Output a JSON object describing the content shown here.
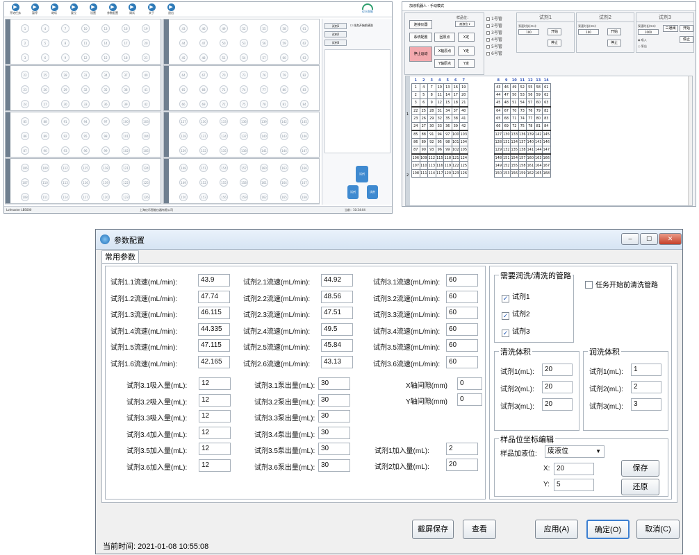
{
  "screen1": {
    "toolbar": [
      {
        "label": "开始任务",
        "icon": "play-icon"
      },
      {
        "label": "暂停",
        "icon": "pause-icon"
      },
      {
        "label": "继续",
        "icon": "resume-icon"
      },
      {
        "label": "复位",
        "icon": "reset-icon"
      },
      {
        "label": "设置",
        "icon": "gear-icon"
      },
      {
        "label": "参数配置",
        "icon": "settings-icon"
      },
      {
        "label": "调试",
        "icon": "debug-icon"
      },
      {
        "label": "关于",
        "icon": "info-icon"
      },
      {
        "label": "退出",
        "icon": "exit-icon"
      }
    ],
    "rows": [
      [
        1,
        4,
        7,
        10,
        13,
        16,
        19
      ],
      [
        2,
        5,
        8,
        11,
        14,
        17,
        20
      ],
      [
        3,
        6,
        9,
        12,
        15,
        18,
        21
      ],
      [
        22,
        25,
        28,
        31,
        34,
        37,
        40
      ],
      [
        23,
        26,
        29,
        32,
        35,
        38,
        41
      ],
      [
        24,
        27,
        30,
        33,
        36,
        39,
        42
      ],
      [
        85,
        88,
        91,
        94,
        97,
        100,
        103
      ],
      [
        86,
        89,
        92,
        95,
        98,
        101,
        104
      ],
      [
        87,
        90,
        93,
        96,
        99,
        102,
        105
      ],
      [
        106,
        109,
        112,
        115,
        118,
        121,
        124
      ],
      [
        107,
        110,
        113,
        116,
        119,
        122,
        125
      ],
      [
        108,
        111,
        114,
        117,
        120,
        123,
        126
      ]
    ],
    "rows_right": [
      [
        43,
        46,
        49,
        52,
        55,
        58,
        61
      ],
      [
        44,
        47,
        50,
        53,
        56,
        59,
        62
      ],
      [
        45,
        48,
        51,
        54,
        57,
        60,
        63
      ],
      [
        64,
        67,
        70,
        73,
        76,
        79,
        82
      ],
      [
        65,
        68,
        71,
        74,
        77,
        80,
        83
      ],
      [
        66,
        69,
        72,
        75,
        78,
        81,
        84
      ],
      [
        127,
        130,
        133,
        136,
        139,
        142,
        145
      ],
      [
        128,
        131,
        134,
        137,
        140,
        143,
        146
      ],
      [
        129,
        132,
        135,
        138,
        141,
        144,
        147
      ],
      [
        148,
        151,
        154,
        157,
        160,
        163,
        166
      ],
      [
        149,
        152,
        155,
        158,
        161,
        164,
        167
      ],
      [
        150,
        153,
        156,
        159,
        162,
        165,
        168
      ]
    ],
    "side_buttons": [
      "试剂1",
      "试剂2",
      "试剂3"
    ],
    "side_check": "任务开始前清洗",
    "logo": "仪乐智能",
    "bottle_label": "试剂",
    "status_left": "Lofmaster  LBS000",
    "status_mid": "上海仪乐智能仪器有限公司",
    "status_right": "当前：10:34:04"
  },
  "screen2": {
    "title": "加液机器人 - 手动模式",
    "buttons": [
      "连接仪器",
      "系统配置",
      "回原点",
      "停止运动",
      "X轴原点",
      "Y轴原点",
      "X定",
      "Y走",
      "Y定"
    ],
    "sample_label": "样品位：",
    "sample_value": "废液位",
    "tubes": [
      "1号管",
      "2号管",
      "3号管",
      "4号管",
      "5号管",
      "6号管"
    ],
    "panels": [
      {
        "title": "试剂1",
        "pump_label": "泵速时长(ms):",
        "pump_value": "100",
        "start": "开始",
        "stop": "停止"
      },
      {
        "title": "试剂2",
        "pump_label": "泵速时长(ms):",
        "pump_value": "100",
        "start": "开始",
        "stop": "停止"
      },
      {
        "title": "试剂3",
        "pump_label": "泵速时长(ms):",
        "pump_value": "1000",
        "start": "开始",
        "stop": "停止",
        "channel": "三通阀",
        "opt1": "吸入",
        "opt2": "泵出"
      }
    ],
    "col_headers_left": [
      "1",
      "2",
      "3",
      "4",
      "5",
      "6",
      "7"
    ],
    "col_headers_right": [
      "8",
      "9",
      "10",
      "11",
      "12",
      "13",
      "14"
    ],
    "side_nums": [
      "1",
      "2"
    ]
  },
  "screen3": {
    "title": "参数配置",
    "tab": "常用参数",
    "rates": {
      "r1": [
        {
          "label": "试剂1.1流速(mL/min):",
          "value": "43.9"
        },
        {
          "label": "试剂1.2流速(mL/min):",
          "value": "47.74"
        },
        {
          "label": "试剂1.3流速(mL/min):",
          "value": "46.115"
        },
        {
          "label": "试剂1.4流速(mL/min):",
          "value": "44.335"
        },
        {
          "label": "试剂1.5流速(mL/min):",
          "value": "47.115"
        },
        {
          "label": "试剂1.6流速(mL/min):",
          "value": "42.165"
        }
      ],
      "r2": [
        {
          "label": "试剂2.1流速(mL/min):",
          "value": "44.92"
        },
        {
          "label": "试剂2.2流速(mL/min):",
          "value": "48.56"
        },
        {
          "label": "试剂2.3流速(mL/min):",
          "value": "47.51"
        },
        {
          "label": "试剂2.4流速(mL/min):",
          "value": "49.5"
        },
        {
          "label": "试剂2.5流速(mL/min):",
          "value": "45.84"
        },
        {
          "label": "试剂2.6流速(mL/min):",
          "value": "43.13"
        }
      ],
      "r3": [
        {
          "label": "试剂3.1流速(mL/min):",
          "value": "60"
        },
        {
          "label": "试剂3.2流速(mL/min):",
          "value": "60"
        },
        {
          "label": "试剂3.3流速(mL/min):",
          "value": "60"
        },
        {
          "label": "试剂3.4流速(mL/min):",
          "value": "60"
        },
        {
          "label": "试剂3.5流速(mL/min):",
          "value": "60"
        },
        {
          "label": "试剂3.6流速(mL/min):",
          "value": "60"
        }
      ]
    },
    "absorb": [
      {
        "label": "试剂3.1吸入量(mL):",
        "value": "12"
      },
      {
        "label": "试剂3.2吸入量(mL):",
        "value": "12"
      },
      {
        "label": "试剂3.3吸入量(mL):",
        "value": "12"
      },
      {
        "label": "试剂3.4加入量(mL):",
        "value": "12"
      },
      {
        "label": "试剂3.5加入量(mL):",
        "value": "12"
      },
      {
        "label": "试剂3.6加入量(mL):",
        "value": "12"
      }
    ],
    "pump": [
      {
        "label": "试剂3.1泵出量(mL):",
        "value": "30"
      },
      {
        "label": "试剂3.2泵出量(mL):",
        "value": "30"
      },
      {
        "label": "试剂3.3泵出量(mL):",
        "value": "30"
      },
      {
        "label": "试剂3.4泵出量(mL):",
        "value": "30"
      },
      {
        "label": "试剂3.5泵出量(mL):",
        "value": "30"
      },
      {
        "label": "试剂3.6泵出量(mL):",
        "value": "30"
      }
    ],
    "x_gap_label": "X轴间隙(mm)",
    "x_gap_value": "0",
    "y_gap_label": "Y轴间隙(mm)",
    "y_gap_value": "0",
    "add1_label": "试剂1加入量(mL):",
    "add1_value": "2",
    "add2_label": "试剂2加入量(mL):",
    "add2_value": "20",
    "pipes_group": "需要润洗/清洗的管路",
    "pipes": [
      "试剂1",
      "试剂2",
      "试剂3"
    ],
    "prewash": "任务开始前清洗管路",
    "clean_group": "清洗体积",
    "clean": [
      {
        "label": "试剂1(mL):",
        "value": "20"
      },
      {
        "label": "试剂2(mL):",
        "value": "20"
      },
      {
        "label": "试剂3(mL):",
        "value": "20"
      }
    ],
    "rinse_group": "润洗体积",
    "rinse": [
      {
        "label": "试剂1(mL):",
        "value": "1"
      },
      {
        "label": "试剂2(mL):",
        "value": "2"
      },
      {
        "label": "试剂3(mL):",
        "value": "3"
      }
    ],
    "coord_group": "样品位坐标编辑",
    "pos_label": "样品加液位:",
    "pos_value": "废液位",
    "x_label": "X:",
    "x_value": "20",
    "y_label": "Y:",
    "y_value": "5",
    "save": "保存",
    "restore": "还原",
    "screenshot_btn": "截屏保存",
    "view_btn": "查看",
    "apply_btn": "应用(A)",
    "ok_btn": "确定(O)",
    "cancel_btn": "取消(C)",
    "time_label": "当前时间:",
    "time_value": "2021-01-08 10:55:08",
    "minimize": "–",
    "maximize": "☐",
    "close": "✕"
  }
}
